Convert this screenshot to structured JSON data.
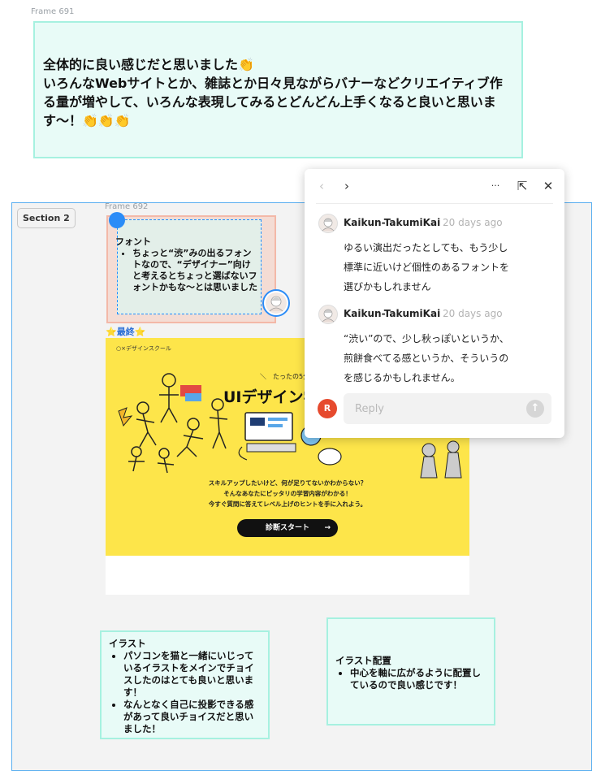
{
  "frames": {
    "frame_691_label": "Frame 691",
    "frame_692_label": "Frame 692"
  },
  "top_note": {
    "line1": "全体的に良い感じだと思いました👏",
    "line2": "いろんなWebサイトとか、雑誌とか日々見ながらバナーなどクリエイティブ作る量が増やして、いろんな表現してみるとどんどん上手くなると良いと思います〜！👏👏👏"
  },
  "section": {
    "label": "Section 2"
  },
  "font_note": {
    "title": "フォント",
    "bullet": "ちょっと“渋”みの出るフォントなので、“デザイナー”向けと考えるとちょっと選ばないフォントかもな〜とは思いました"
  },
  "final_label": "⭐最終⭐",
  "banner": {
    "brand": "○×デザインスクール",
    "tagline": "＼　たったの5分！",
    "title": "UIデザイン学",
    "copy_lines": [
      "スキルアップしたいけど、何が足りてないかわからない？",
      "そんなあなたにピッタリの学習内容がわかる！",
      "今すぐ質問に答えてレベル上げのヒントを手に入れよう。"
    ],
    "cta_label": "診断スタート",
    "cta_arrow": "→",
    "colors": {
      "background": "#fde54a",
      "cta": "#111111"
    }
  },
  "illust_note": {
    "title": "イラスト",
    "bullets": [
      "パソコンを猫と一緒にいじっているイラストをメインでチョイスしたのはとても良いと思います！",
      "なんとなく自己に投影できる感があって良いチョイスだと思いました！"
    ]
  },
  "placement_note": {
    "title": "イラスト配置",
    "bullets": [
      "中心を軸に広がるように配置しているので良い感じです！"
    ]
  },
  "comment_panel": {
    "icons": [
      "chevron-left-icon",
      "chevron-right-icon",
      "more-icon",
      "collapse-icon",
      "close-icon"
    ],
    "glyphs": {
      "prev": "‹",
      "next": "›",
      "more": "···",
      "collapse": "⇱",
      "close": "✕"
    },
    "comments": [
      {
        "author": "Kaikun-TakumiKai",
        "time": "20 days ago",
        "lines": [
          "ゆるい演出だったとしても、もう少し",
          "標準に近いけど個性のあるフォントを",
          "選びかもしれません"
        ]
      },
      {
        "author": "Kaikun-TakumiKai",
        "time": "20 days ago",
        "lines": [
          "“渋い”ので、少し秋っぽいというか、",
          "煎餅食べてる感というか、そういうの",
          "を感じるかもしれません。"
        ]
      }
    ],
    "reply": {
      "avatar_letter": "R",
      "placeholder": "Reply",
      "send_glyph": "↑"
    },
    "colors": {
      "reply_avatar": "#e64a2e",
      "accent": "#2b8cf7"
    }
  }
}
